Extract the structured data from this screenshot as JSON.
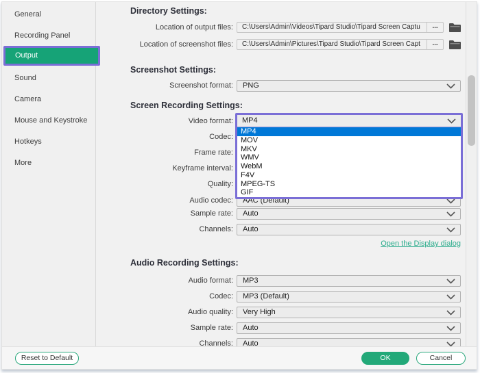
{
  "colors": {
    "accent_green": "#16a377",
    "accent_purple": "#7a6ed6",
    "selection_blue": "#0078d7",
    "link_green": "#2bac8c"
  },
  "icons": {
    "chevron_down": "chevron-down",
    "folder": "folder",
    "browse_dots": "..."
  },
  "sidebar": {
    "items": [
      {
        "label": "General",
        "active": false
      },
      {
        "label": "Recording Panel",
        "active": false
      },
      {
        "label": "Output",
        "active": true
      },
      {
        "label": "Sound",
        "active": false
      },
      {
        "label": "Camera",
        "active": false
      },
      {
        "label": "Mouse and Keystroke",
        "active": false
      },
      {
        "label": "Hotkeys",
        "active": false
      },
      {
        "label": "More",
        "active": false
      }
    ]
  },
  "directory": {
    "heading": "Directory Settings:",
    "rows": [
      {
        "label": "Location of output files:",
        "value": "C:\\Users\\Admin\\Videos\\Tipard Studio\\Tipard Screen Captu",
        "browse": "..."
      },
      {
        "label": "Location of screenshot files:",
        "value": "C:\\Users\\Admin\\Pictures\\Tipard Studio\\Tipard Screen Capt",
        "browse": "..."
      }
    ]
  },
  "screenshot": {
    "heading": "Screenshot Settings:",
    "format_label": "Screenshot format:",
    "format_value": "PNG"
  },
  "recording": {
    "heading": "Screen Recording Settings:",
    "video_format_label": "Video format:",
    "video_format_value": "MP4",
    "dropdown_options": [
      "MP4",
      "MOV",
      "MKV",
      "WMV",
      "WebM",
      "F4V",
      "MPEG-TS",
      "GIF"
    ],
    "dropdown_selected": "MP4",
    "covered_labels": [
      "Codec:",
      "Frame rate:",
      "Keyframe interval:",
      "Quality:"
    ],
    "audio_codec_label": "Audio codec:",
    "audio_codec_value": "AAC (Default)",
    "sample_rate_label": "Sample rate:",
    "sample_rate_value": "Auto",
    "channels_label": "Channels:",
    "channels_value": "Auto",
    "display_dialog_link": "Open the Display dialog"
  },
  "audio": {
    "heading": "Audio Recording Settings:",
    "rows": [
      {
        "label": "Audio format:",
        "value": "MP3"
      },
      {
        "label": "Codec:",
        "value": "MP3 (Default)"
      },
      {
        "label": "Audio quality:",
        "value": "Very High"
      },
      {
        "label": "Sample rate:",
        "value": "Auto"
      },
      {
        "label": "Channels:",
        "value": "Auto"
      }
    ]
  },
  "footer": {
    "reset_label": "Reset to Default",
    "ok_label": "OK",
    "cancel_label": "Cancel"
  }
}
